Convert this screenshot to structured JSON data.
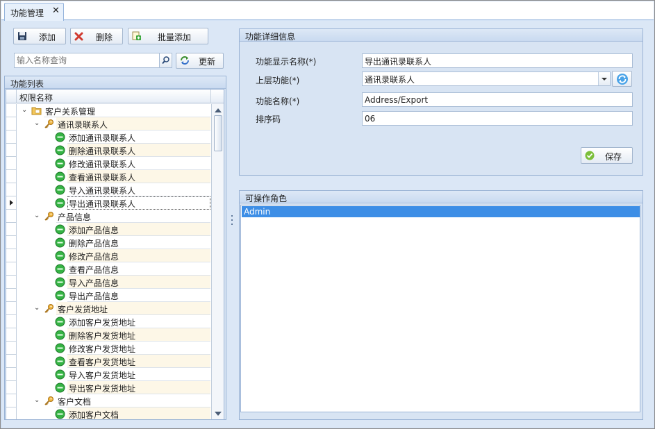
{
  "window": {
    "tab_label": "功能管理",
    "tab_close": "✕"
  },
  "toolbar": {
    "add_label": "添加",
    "delete_label": "删除",
    "batch_add_label": "批量添加",
    "search_placeholder": "输入名称查询",
    "refresh_label": "更新"
  },
  "function_list": {
    "title": "功能列表",
    "column_header": "权限名称",
    "rows": [
      {
        "label": "客户关系管理",
        "level": 0,
        "type": "folder",
        "expanded": true
      },
      {
        "label": "通讯录联系人",
        "level": 1,
        "type": "key",
        "expanded": true
      },
      {
        "label": "添加通讯录联系人",
        "level": 2,
        "type": "leaf"
      },
      {
        "label": "删除通讯录联系人",
        "level": 2,
        "type": "leaf"
      },
      {
        "label": "修改通讯录联系人",
        "level": 2,
        "type": "leaf"
      },
      {
        "label": "查看通讯录联系人",
        "level": 2,
        "type": "leaf"
      },
      {
        "label": "导入通讯录联系人",
        "level": 2,
        "type": "leaf"
      },
      {
        "label": "导出通讯录联系人",
        "level": 2,
        "type": "leaf",
        "selected": true
      },
      {
        "label": "产品信息",
        "level": 1,
        "type": "key",
        "expanded": true
      },
      {
        "label": "添加产品信息",
        "level": 2,
        "type": "leaf"
      },
      {
        "label": "删除产品信息",
        "level": 2,
        "type": "leaf"
      },
      {
        "label": "修改产品信息",
        "level": 2,
        "type": "leaf"
      },
      {
        "label": "查看产品信息",
        "level": 2,
        "type": "leaf"
      },
      {
        "label": "导入产品信息",
        "level": 2,
        "type": "leaf"
      },
      {
        "label": "导出产品信息",
        "level": 2,
        "type": "leaf"
      },
      {
        "label": "客户发货地址",
        "level": 1,
        "type": "key",
        "expanded": true
      },
      {
        "label": "添加客户发货地址",
        "level": 2,
        "type": "leaf"
      },
      {
        "label": "删除客户发货地址",
        "level": 2,
        "type": "leaf"
      },
      {
        "label": "修改客户发货地址",
        "level": 2,
        "type": "leaf"
      },
      {
        "label": "查看客户发货地址",
        "level": 2,
        "type": "leaf"
      },
      {
        "label": "导入客户发货地址",
        "level": 2,
        "type": "leaf"
      },
      {
        "label": "导出客户发货地址",
        "level": 2,
        "type": "leaf"
      },
      {
        "label": "客户文档",
        "level": 1,
        "type": "key",
        "expanded": true
      },
      {
        "label": "添加客户文档",
        "level": 2,
        "type": "leaf"
      }
    ]
  },
  "detail": {
    "title": "功能详细信息",
    "display_name_label": "功能显示名称(*)",
    "display_name_value": "导出通讯录联系人",
    "parent_label": "上层功能(*)",
    "parent_value": "通讯录联系人",
    "function_name_label": "功能名称(*)",
    "function_name_value": "Address/Export",
    "sort_label": "排序码",
    "sort_value": "06",
    "save_label": "保存"
  },
  "roles": {
    "title": "可操作角色",
    "items": [
      {
        "label": "Admin",
        "selected": true
      }
    ]
  },
  "colors": {
    "accent": "#3d8ee6",
    "background": "#dbe7f6",
    "group_border": "#9ab3d5",
    "alt_row": "#fdf7e7"
  }
}
